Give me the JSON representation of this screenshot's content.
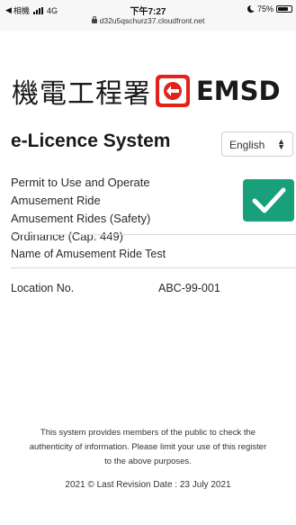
{
  "status_bar": {
    "carrier": "相機",
    "network": "4G",
    "time": "下午7:27",
    "url": "d32u5qschurz37.cloudfront.net",
    "battery": "75%",
    "battery_level": 0.75
  },
  "logo": {
    "chinese": "機電工程署",
    "english": "EMSD"
  },
  "header": {
    "title": "e-Licence System",
    "language_selected": "English"
  },
  "permit": {
    "lines": [
      "Permit to Use and Operate",
      "Amusement Ride",
      "Amusement Rides (Safety)",
      "Ordinance (Cap. 449)"
    ],
    "status_icon": "checkmark-icon",
    "status_color": "#17a07a"
  },
  "details": {
    "ride_name": "Name of Amusement Ride Test",
    "location_label": "Location No.",
    "location_value": "ABC-99-001"
  },
  "footer": {
    "lines": [
      "This system provides members of the public to check the",
      "authenticity of information. Please limit your use of this register",
      "to the above purposes."
    ],
    "revision": "2021 © Last Revision Date : 23 July 2021"
  }
}
